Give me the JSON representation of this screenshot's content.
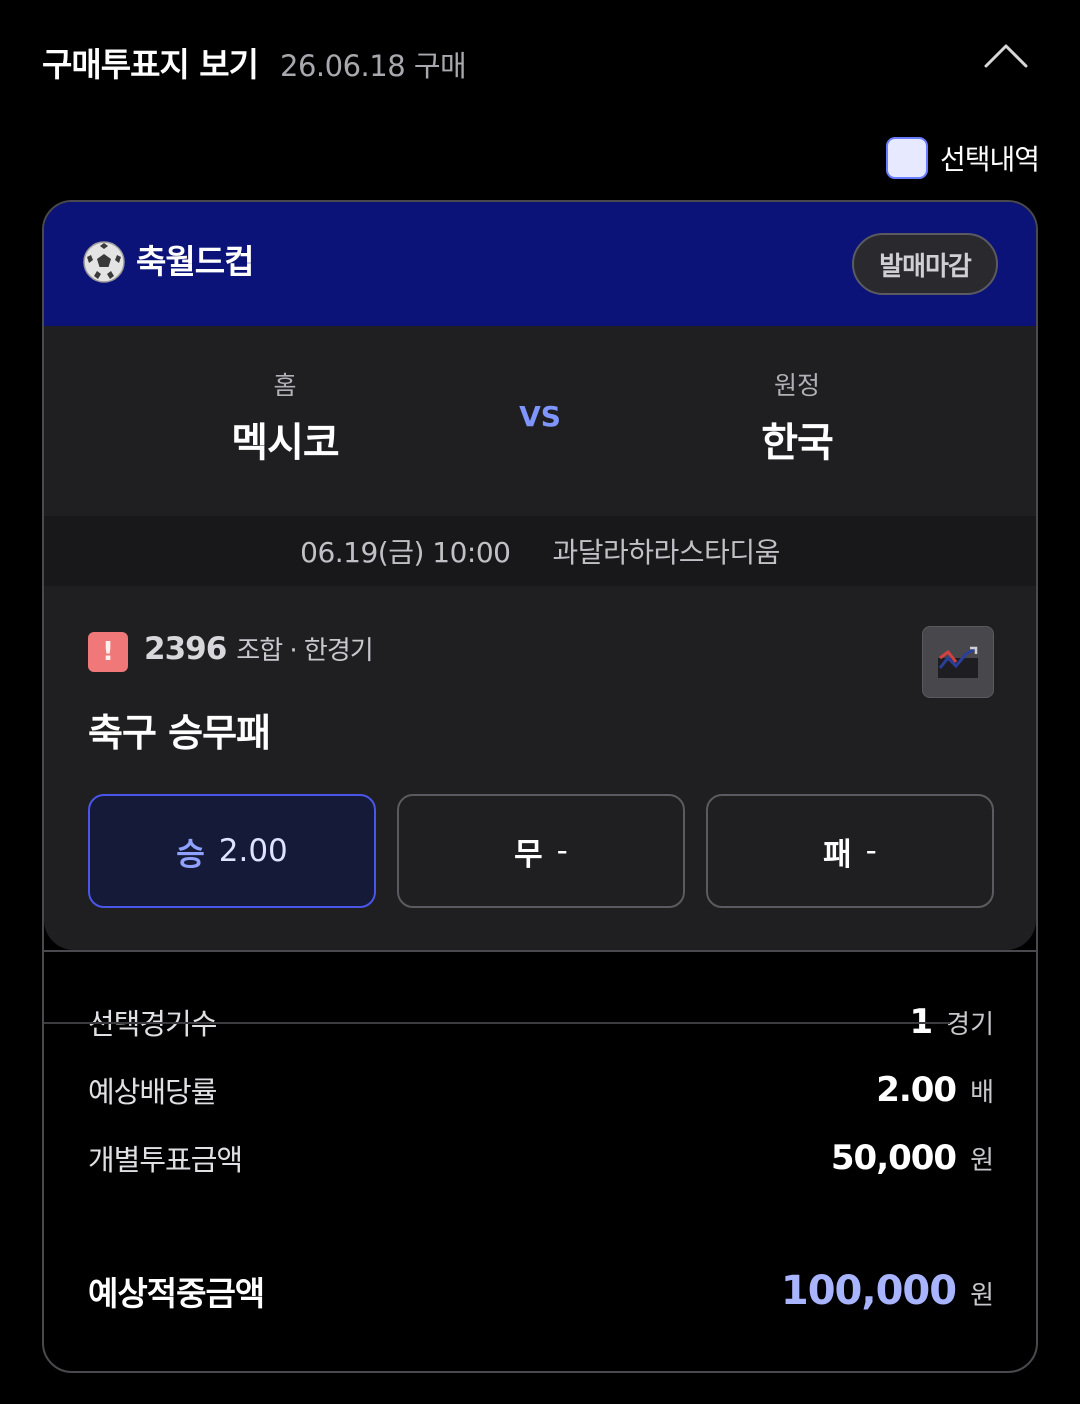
{
  "header": {
    "title": "구매투표지 보기",
    "purchase_date": "26.06.18 구매"
  },
  "selection": {
    "label": "선택내역"
  },
  "league": {
    "name": "축월드컵",
    "status": "발매마감"
  },
  "match": {
    "home_role": "홈",
    "home_team": "멕시코",
    "vs": "VS",
    "away_role": "원정",
    "away_team": "한국",
    "datetime": "06.19(금) 10:00",
    "venue": "과달라하라스타디움"
  },
  "bet": {
    "alert_mark": "!",
    "combo_number": "2396",
    "combo_text": "조합 · 한경기",
    "game_type": "축구 승무패",
    "options": [
      {
        "label": "승",
        "value": "2.00",
        "selected": true
      },
      {
        "label": "무",
        "value": "-",
        "selected": false
      },
      {
        "label": "패",
        "value": "-",
        "selected": false
      }
    ]
  },
  "summary": {
    "games_label": "선택경기수",
    "games_value": "1",
    "games_unit": "경기",
    "odds_label": "예상배당률",
    "odds_value": "2.00",
    "odds_unit": "배",
    "stake_label": "개별투표금액",
    "stake_value": "50,000",
    "stake_unit": "원",
    "payout_label": "예상적중금액",
    "payout_value": "100,000",
    "payout_unit": "원"
  },
  "colors": {
    "league_bar": "#0b1378",
    "accent": "#4a56e8",
    "payout": "#a9b4ff",
    "alert": "#f07878"
  }
}
